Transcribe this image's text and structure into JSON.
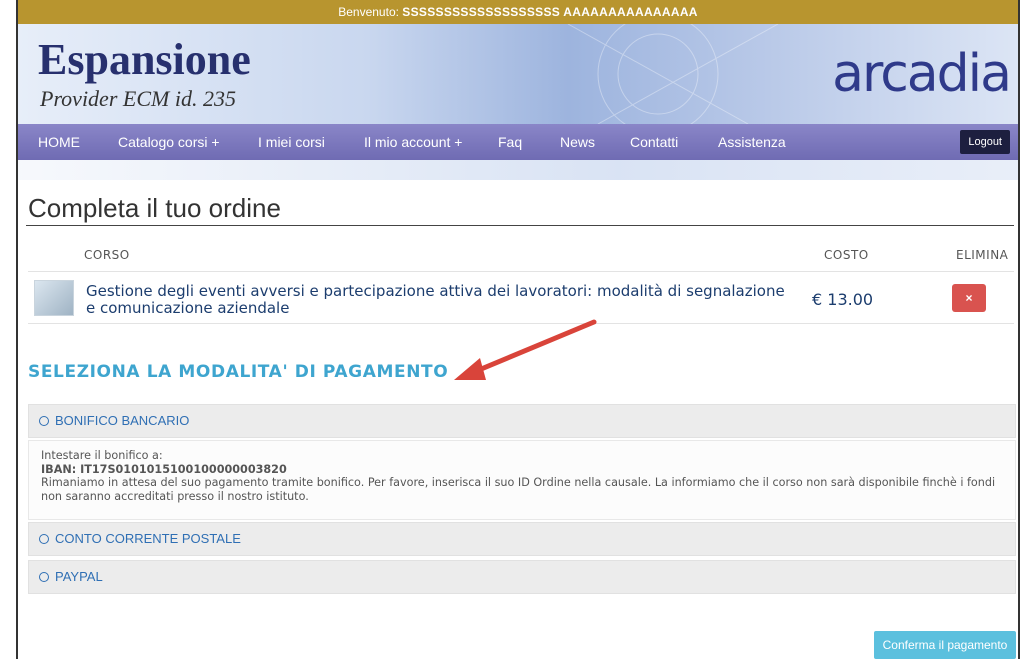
{
  "header": {
    "welcome_label": "Benvenuto:",
    "user_name": "SSSSSSSSSSSSSSSSSSS AAAAAAAAAAAAAAA",
    "brand_title": "Espansione",
    "brand_subtitle": "Provider ECM id. 235",
    "logo_text": "arcadia"
  },
  "nav": {
    "items": [
      "HOME",
      "Catalogo corsi +",
      "I miei corsi",
      "Il mio account +",
      "Faq",
      "News",
      "Contatti",
      "Assistenza"
    ],
    "logout": "Logout"
  },
  "page": {
    "title": "Completa il tuo ordine"
  },
  "order_table": {
    "headers": {
      "course": "CORSO",
      "cost": "COSTO",
      "delete": "ELIMINA"
    },
    "rows": [
      {
        "course_name": "Gestione degli eventi avversi e partecipazione attiva dei lavoratori: modalità di segnalazione e comunicazione aziendale",
        "price": "€ 13.00",
        "delete_icon": "×"
      }
    ]
  },
  "payment": {
    "section_title": "SELEZIONA LA MODALITA' DI PAGAMENTO",
    "options": [
      "BONIFICO BANCARIO",
      "CONTO CORRENTE POSTALE",
      "PAYPAL"
    ],
    "bank_details": {
      "intro": "Intestare il bonifico a:",
      "iban": "IBAN: IT17S0101015100100000003820",
      "note": "Rimaniamo in attesa del suo pagamento tramite bonifico. Per favore, inserisca il suo ID Ordine nella causale. La informiamo che il corso non sarà disponibile finchè i fondi non saranno accreditati presso il nostro istituto."
    },
    "confirm": "Conferma il pagamento"
  },
  "colors": {
    "welcome_bar": "#b8952f",
    "nav": "#7874bd",
    "section_title": "#3ea5cf",
    "delete_button": "#d9534f",
    "confirm_button": "#5bc0de",
    "annotation_arrow": "#d9443a"
  }
}
